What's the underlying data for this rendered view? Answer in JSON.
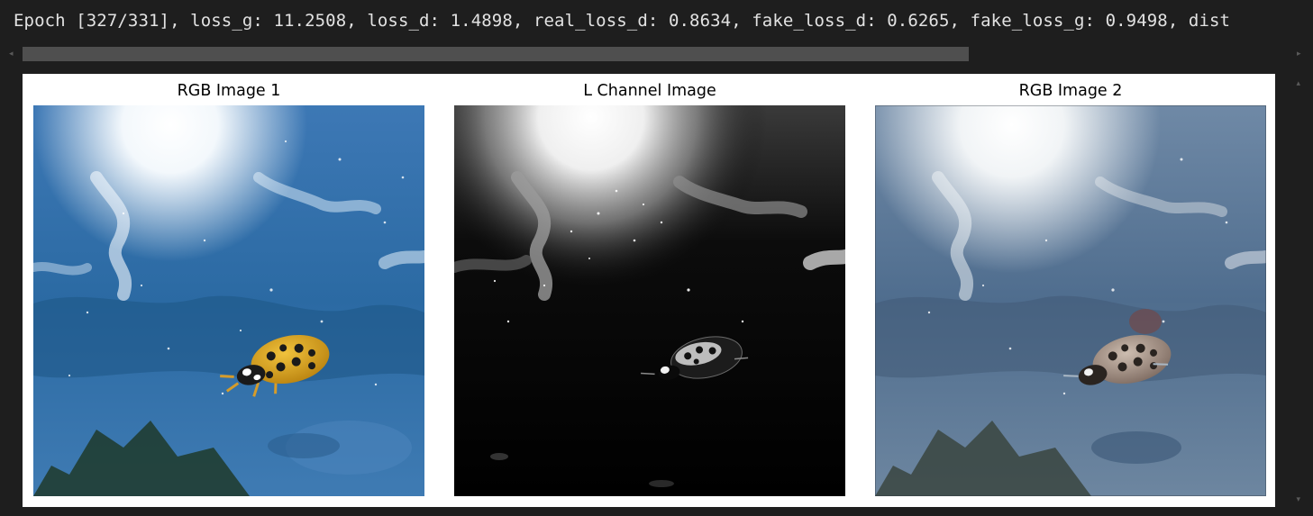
{
  "output": {
    "log_line": "Epoch [327/331], loss_g: 11.2508, loss_d: 1.4898, real_loss_d: 0.8634, fake_loss_d: 0.6265, fake_loss_g: 0.9498, dist"
  },
  "figure": {
    "panels": [
      {
        "title": "RGB Image 1"
      },
      {
        "title": "L Channel Image"
      },
      {
        "title": "RGB Image 2"
      }
    ]
  },
  "colors": {
    "background": "#1e1e1e",
    "scroll_thumb": "#4f4f4f",
    "figure_bg": "#ffffff"
  }
}
